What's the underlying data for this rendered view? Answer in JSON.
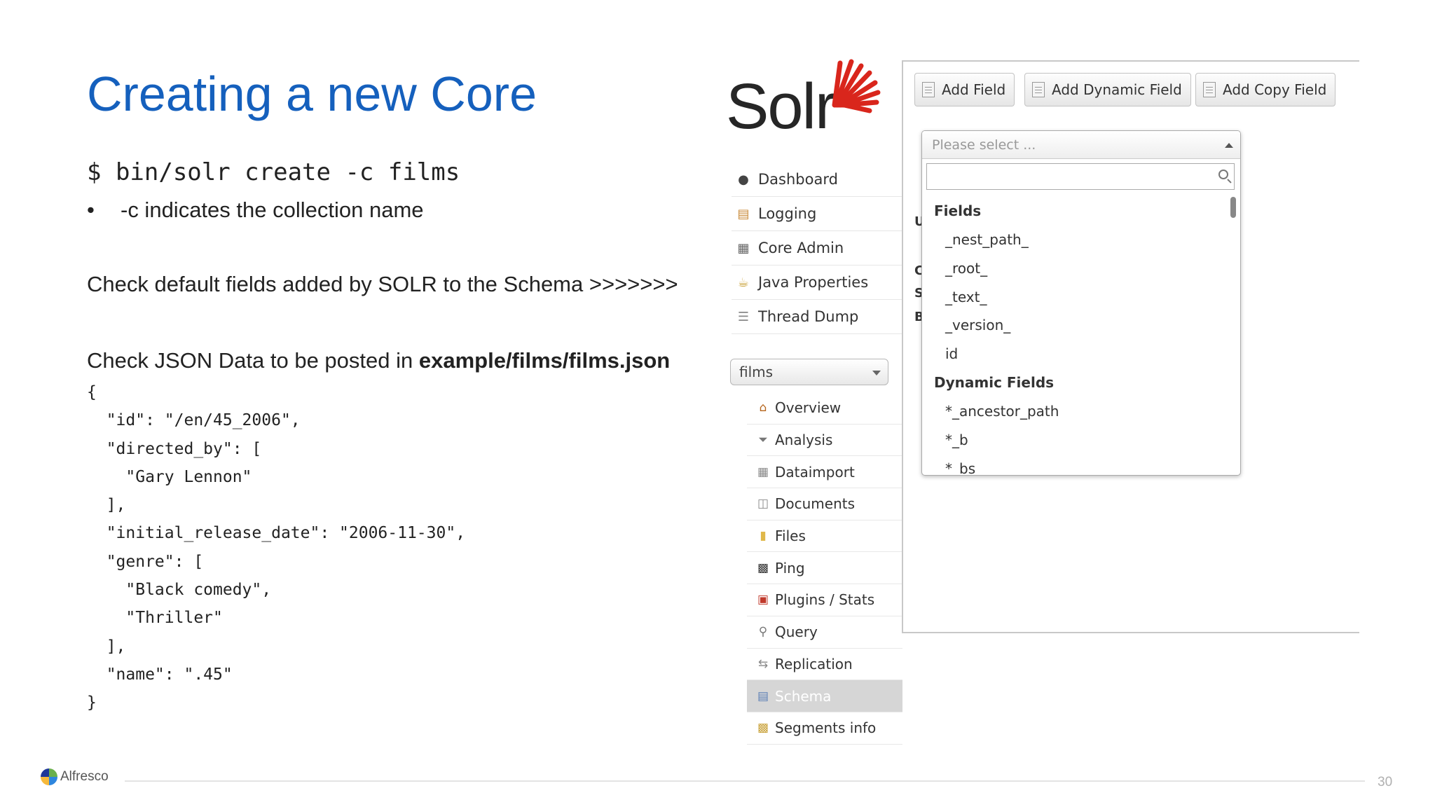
{
  "slide": {
    "title": "Creating a new Core",
    "command": "$ bin/solr create -c films",
    "bullet": "-c indicates the collection name",
    "line_check_fields": "Check default fields added by SOLR to the Schema >>>>>>>",
    "line_check_json_prefix": "Check JSON Data to be posted in ",
    "line_check_json_path": "example/films/films.json",
    "code": "{\n  \"id\": \"/en/45_2006\",\n  \"directed_by\": [\n    \"Gary Lennon\"\n  ],\n  \"initial_release_date\": \"2006-11-30\",\n  \"genre\": [\n    \"Black comedy\",\n    \"Thriller\"\n  ],\n  \"name\": \".45\"\n}",
    "page_number": "30",
    "footer_brand": "Alfresco"
  },
  "solr": {
    "logo_text": "Solr",
    "nav": [
      {
        "label": "Dashboard",
        "icon": "dashboard-icon"
      },
      {
        "label": "Logging",
        "icon": "logging-icon"
      },
      {
        "label": "Core Admin",
        "icon": "core-admin-icon"
      },
      {
        "label": "Java Properties",
        "icon": "java-icon"
      },
      {
        "label": "Thread Dump",
        "icon": "thread-dump-icon"
      }
    ],
    "core_selector": "films",
    "core_nav": [
      {
        "label": "Overview",
        "icon": "home-icon"
      },
      {
        "label": "Analysis",
        "icon": "funnel-icon"
      },
      {
        "label": "Dataimport",
        "icon": "dataimport-icon"
      },
      {
        "label": "Documents",
        "icon": "documents-icon"
      },
      {
        "label": "Files",
        "icon": "folder-icon"
      },
      {
        "label": "Ping",
        "icon": "ping-icon"
      },
      {
        "label": "Plugins / Stats",
        "icon": "plugins-icon"
      },
      {
        "label": "Query",
        "icon": "magnifier-icon"
      },
      {
        "label": "Replication",
        "icon": "replication-icon"
      },
      {
        "label": "Schema",
        "icon": "schema-icon"
      },
      {
        "label": "Segments info",
        "icon": "segments-icon"
      }
    ],
    "active_item": "Schema",
    "buttons": {
      "add_field": "Add Field",
      "add_dynamic_field": "Add Dynamic Field",
      "add_copy_field": "Add Copy Field"
    },
    "side_letters": [
      "U",
      "C",
      "S",
      "B"
    ],
    "dropdown": {
      "placeholder": "Please select ...",
      "search_value": "",
      "groups": [
        {
          "label": "Fields",
          "options": [
            "_nest_path_",
            "_root_",
            "_text_",
            "_version_",
            "id"
          ]
        },
        {
          "label": "Dynamic Fields",
          "options": [
            "*_ancestor_path",
            "*_b",
            "*_bs"
          ]
        }
      ]
    }
  },
  "colors": {
    "title_blue": "#1560bd",
    "solr_red": "#d9261c",
    "active_bg": "#d6d6d6"
  }
}
